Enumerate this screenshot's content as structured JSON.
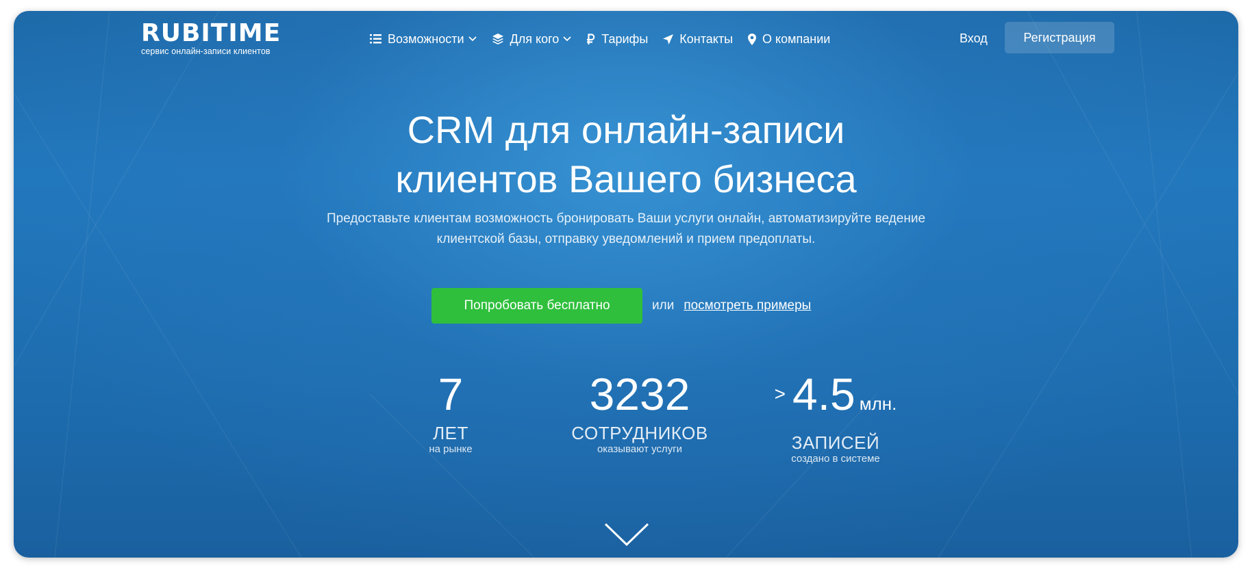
{
  "logo": {
    "wordmark": "RUBITIME",
    "tagline": "сервис онлайн-записи клиентов"
  },
  "nav": {
    "items": [
      {
        "label": "Возможности",
        "icon": "list-icon",
        "has_dropdown": true
      },
      {
        "label": "Для кого",
        "icon": "layers-icon",
        "has_dropdown": true
      },
      {
        "label": "Тарифы",
        "icon": "ruble-icon",
        "has_dropdown": false
      },
      {
        "label": "Контакты",
        "icon": "send-arrow-icon",
        "has_dropdown": false
      },
      {
        "label": "О компании",
        "icon": "map-pin-icon",
        "has_dropdown": false
      }
    ],
    "login_label": "Вход",
    "register_label": "Регистрация"
  },
  "hero": {
    "title_line1": "CRM для онлайн-записи",
    "title_line2": "клиентов Вашего бизнеса",
    "subtitle_line1": "Предоставьте клиентам возможность бронировать Ваши услуги онлайн, автоматизируйте ведение",
    "subtitle_line2": "клиентской базы, отправку уведомлений и прием предоплаты.",
    "cta_label": "Попробовать бесплатно",
    "or_text": "или",
    "examples_link": "посмотреть примеры"
  },
  "stats": [
    {
      "prefix": "",
      "number": "7",
      "suffix": "",
      "label": "ЛЕТ",
      "caption": "на рынке"
    },
    {
      "prefix": "",
      "number": "3232",
      "suffix": "",
      "label": "СОТРУДНИКОВ",
      "caption": "оказывают услуги"
    },
    {
      "prefix": ">",
      "number": "4.5",
      "suffix": "млн.",
      "label": "ЗАПИСЕЙ",
      "caption": "создано в системе"
    }
  ],
  "colors": {
    "background": "#2278bd",
    "cta_button": "#2fbf3c",
    "text": "#ffffff"
  },
  "scroll_icon": "chevron-down-icon"
}
